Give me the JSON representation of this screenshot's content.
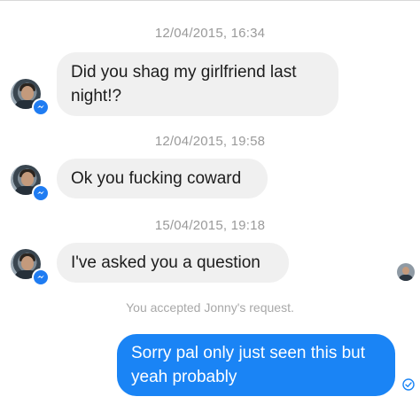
{
  "messages": [
    {
      "timestamp": "12/04/2015, 16:34",
      "text_line1": "Did you shag my girlfriend last",
      "text_line2": "night!?"
    },
    {
      "timestamp": "12/04/2015, 19:58",
      "text": "Ok you fucking coward"
    },
    {
      "timestamp": "15/04/2015, 19:18",
      "text": "I've asked you a question"
    }
  ],
  "system_notice": "You accepted Jonny's request.",
  "reply": {
    "text_line1": "Sorry pal only just seen this but",
    "text_line2": "yeah probably"
  },
  "icons": {
    "badge": "messenger-icon",
    "seen": "seen-avatar-icon",
    "delivered": "check-circle-icon"
  },
  "colors": {
    "outgoing_bubble": "#1a84f5",
    "incoming_bubble": "#f0f0f0",
    "messenger_badge": "#1f7cf2",
    "timestamp_text": "#9a9a9a"
  }
}
